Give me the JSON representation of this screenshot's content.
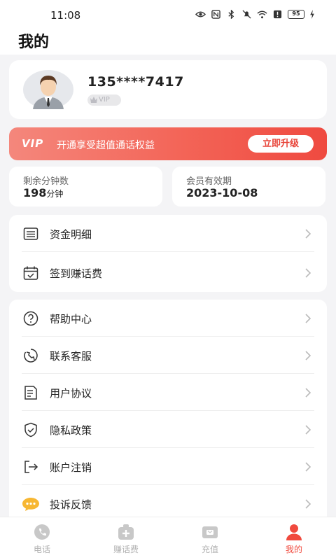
{
  "status_bar": {
    "time": "11:08",
    "battery": "95"
  },
  "header": {
    "title": "我的"
  },
  "profile": {
    "phone": "135****7417",
    "vip_badge": "VIP"
  },
  "vip_banner": {
    "logo": "VIP",
    "text": "开通享受超值通话权益",
    "button": "立即升级"
  },
  "stats": {
    "minutes": {
      "label": "剩余分钟数",
      "value": "198",
      "unit": "分钟"
    },
    "expiry": {
      "label": "会员有效期",
      "value": "2023-10-08"
    }
  },
  "menu_group_1": [
    {
      "label": "资金明细",
      "icon": "ledger-icon"
    },
    {
      "label": "签到赚话费",
      "icon": "calendar-check-icon"
    }
  ],
  "menu_group_2": [
    {
      "label": "帮助中心",
      "icon": "help-icon"
    },
    {
      "label": "联系客服",
      "icon": "customer-service-icon"
    },
    {
      "label": "用户协议",
      "icon": "document-icon"
    },
    {
      "label": "隐私政策",
      "icon": "shield-icon"
    },
    {
      "label": "账户注销",
      "icon": "logout-icon"
    },
    {
      "label": "投诉反馈",
      "icon": "chat-bubble-icon"
    }
  ],
  "tabs": [
    {
      "label": "电话",
      "icon": "phone-icon",
      "active": false
    },
    {
      "label": "赚话费",
      "icon": "bag-icon",
      "active": false
    },
    {
      "label": "充值",
      "icon": "wallet-icon",
      "active": false
    },
    {
      "label": "我的",
      "icon": "user-icon",
      "active": true
    }
  ],
  "colors": {
    "accent": "#f04a3e",
    "banner_start": "#f4877c",
    "banner_end": "#ef4a40",
    "background": "#f4f4f6"
  }
}
